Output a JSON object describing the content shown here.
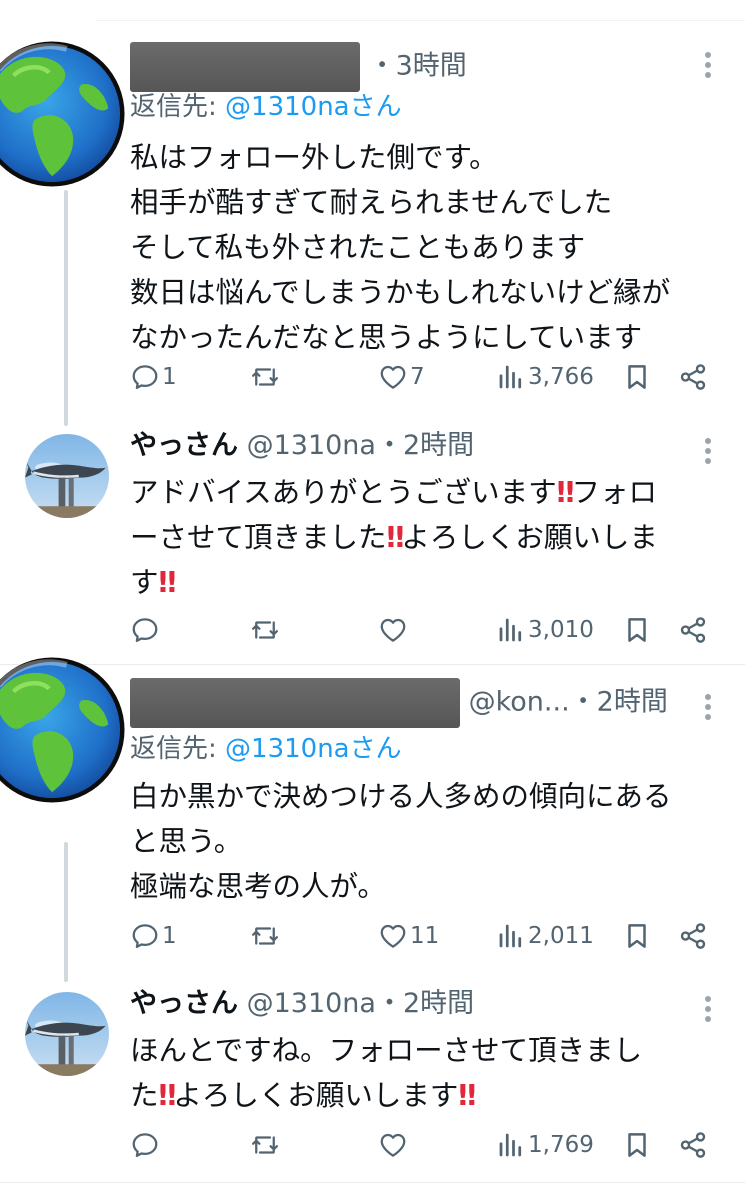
{
  "tweets": [
    {
      "author": "",
      "handle": "",
      "time": "・3時間",
      "reply_prefix": "返信先: ",
      "reply_target": "@1310naさん",
      "lines": [
        "私はフォロー外した側です。",
        "相手が酷すぎて耐えられませんでした",
        "そして私も外されたこともあります",
        "数日は悩んでしまうかもしれないけど縁が",
        "なかったんだなと思うようにしています"
      ],
      "stats": {
        "replies": "1",
        "retweets": "",
        "likes": "7",
        "views": "3,766"
      },
      "avatar_icon": "globe-icon"
    },
    {
      "author": "やっさん",
      "handle": "@1310na",
      "time": "・2時間",
      "text_parts": [
        "アドバイスありがとうございます",
        "‼",
        "フォロ",
        "ーさせて頂きました",
        "‼",
        "よろしくお願いしま",
        "す",
        "‼"
      ],
      "stats": {
        "replies": "",
        "retweets": "",
        "likes": "",
        "views": "3,010"
      },
      "avatar_icon": "whale-statue-icon"
    },
    {
      "author": "",
      "handle": "@kon...",
      "time": "・2時間",
      "reply_prefix": "返信先: ",
      "reply_target": "@1310naさん",
      "lines": [
        "白か黒かで決めつける人多めの傾向にある",
        "と思う。",
        "極端な思考の人が。"
      ],
      "stats": {
        "replies": "1",
        "retweets": "",
        "likes": "11",
        "views": "2,011"
      },
      "avatar_icon": "globe-icon"
    },
    {
      "author": "やっさん",
      "handle": "@1310na",
      "time": "・2時間",
      "text_parts": [
        "ほんとですね。フォローさせて頂きまし",
        "た",
        "‼",
        "よろしくお願いします",
        "‼"
      ],
      "stats": {
        "replies": "",
        "retweets": "",
        "likes": "",
        "views": "1,769"
      },
      "avatar_icon": "whale-statue-icon"
    }
  ],
  "colors": {
    "accent": "#1d9bf0",
    "muted": "#536471",
    "text": "#0f1419",
    "emoji_red": "#e2273a"
  }
}
